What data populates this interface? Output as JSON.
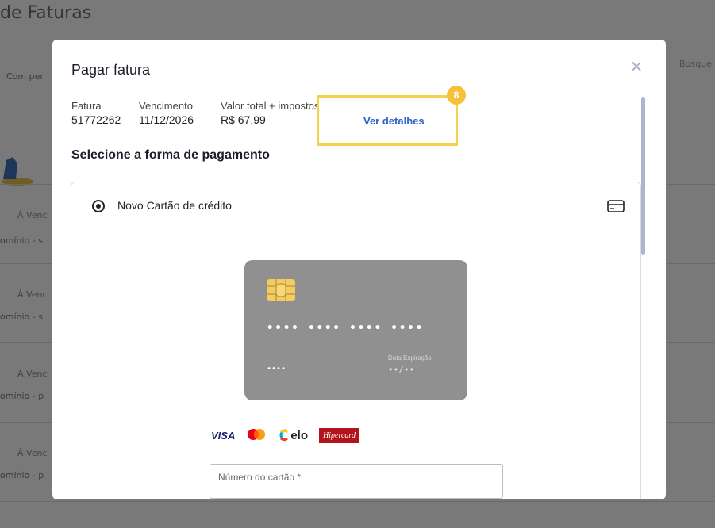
{
  "background": {
    "page_title": "de Faturas",
    "filter_label": "Com per",
    "search_placeholder": "Busque",
    "rows": [
      {
        "status": "À Venc",
        "desc": "omínio - s"
      },
      {
        "status": "À Venc",
        "desc": "omínio - s"
      },
      {
        "status": "À Venc",
        "desc": "omínio - p"
      },
      {
        "status": "À Venc",
        "desc": "omínio - p"
      }
    ]
  },
  "modal": {
    "title": "Pagar fatura",
    "close_icon": "close-icon",
    "invoice": {
      "fatura_label": "Fatura",
      "fatura_value": "51772262",
      "vencimento_label": "Vencimento",
      "vencimento_value": "11/12/2026",
      "total_label": "Valor total + impostos",
      "total_value": "R$ 67,99"
    },
    "details_link": "Ver detalhes",
    "highlight_badge": "8",
    "section_title": "Selecione a forma de pagamento",
    "payment_option": {
      "label": "Novo Cartão de crédito",
      "icon": "credit-card-icon"
    },
    "card_preview": {
      "number": "•••• •••• •••• ••••",
      "name": "••••",
      "expiry_label": "Data Expiração",
      "expiry_value": "••/••"
    },
    "brands": [
      "VISA",
      "mastercard",
      "elo",
      "Hipercard"
    ],
    "card_number_field": {
      "label": "Número do cartão *"
    }
  },
  "colors": {
    "accent_link": "#2a63c9",
    "highlight": "#f5d24b",
    "badge": "#f5c13a",
    "card_bg": "#909090"
  }
}
